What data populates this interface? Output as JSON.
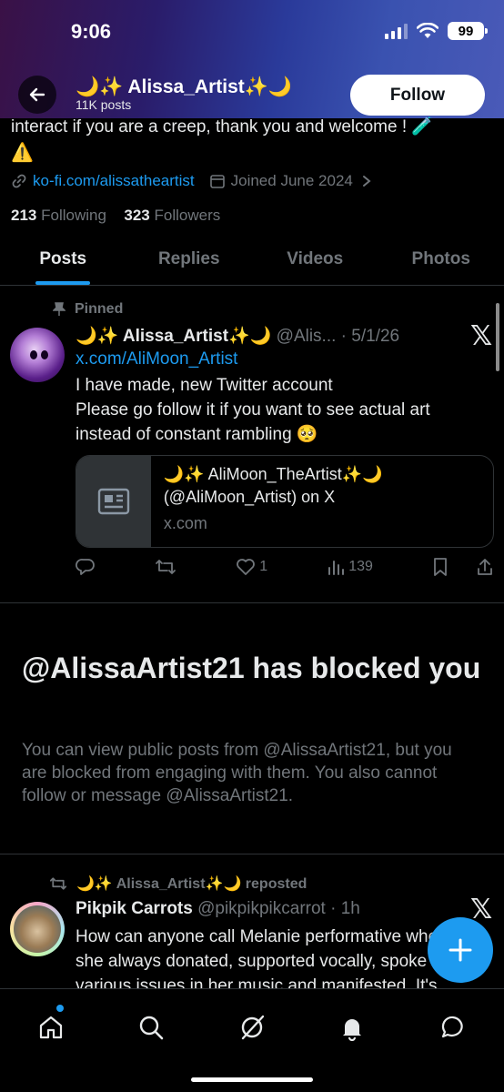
{
  "status_bar": {
    "time": "9:06",
    "battery": "99"
  },
  "header": {
    "name": "🌙✨ Alissa_Artist✨🌙",
    "post_count": "11K posts",
    "follow_label": "Follow"
  },
  "bio": {
    "tail_text": "interact if you are a creep, thank you and welcome ! 🧪",
    "warning": "⚠️"
  },
  "meta": {
    "website": "ko-fi.com/alissatheartist",
    "joined": "Joined June 2024"
  },
  "stats": {
    "following_count": "213",
    "following_label": "Following",
    "followers_count": "323",
    "followers_label": "Followers"
  },
  "tabs": [
    {
      "label": "Posts",
      "active": true
    },
    {
      "label": "Replies"
    },
    {
      "label": "Videos"
    },
    {
      "label": "Photos"
    }
  ],
  "pinned_post": {
    "pinned_label": "Pinned",
    "author_name": "🌙✨ Alissa_Artist✨🌙",
    "handle_date": "@Alis... · 5/1/26",
    "link": "x.com/AliMoon_Artist",
    "body_line1": "I have made, new Twitter account",
    "body_line2": "Please go follow it if you want to see actual art instead of constant rambling 🥺",
    "card": {
      "title": "🌙✨ AliMoon_TheArtist✨🌙 (@AliMoon_Artist) on X",
      "domain": "x.com"
    },
    "likes": "1",
    "views": "139"
  },
  "blocked": {
    "title": "@AlissaArtist21 has blocked you",
    "message": "You can view public posts from @AlissaArtist21, but you are blocked from engaging with them. You also cannot follow or message @AlissaArtist21."
  },
  "repost": {
    "label": "🌙✨ Alissa_Artist✨🌙 reposted",
    "author_name": "Pikpik Carrots",
    "handle_time": "@pikpikpikcarrot · 1h",
    "body": "How can anyone call Melanie performative when she always donated, supported vocally, spoke on various issues in her music and manifested. It's"
  },
  "colors": {
    "accent": "#1d9bf0",
    "background": "#000000",
    "muted": "#71767b"
  },
  "icons": [
    "back-arrow-icon",
    "link-icon",
    "calendar-icon",
    "pin-icon",
    "x-logo-icon",
    "news-icon",
    "reply-icon",
    "retweet-icon",
    "heart-icon",
    "views-icon",
    "bookmark-icon",
    "share-icon",
    "plus-icon",
    "home-icon",
    "search-icon",
    "grok-icon",
    "bell-icon",
    "messages-icon"
  ]
}
